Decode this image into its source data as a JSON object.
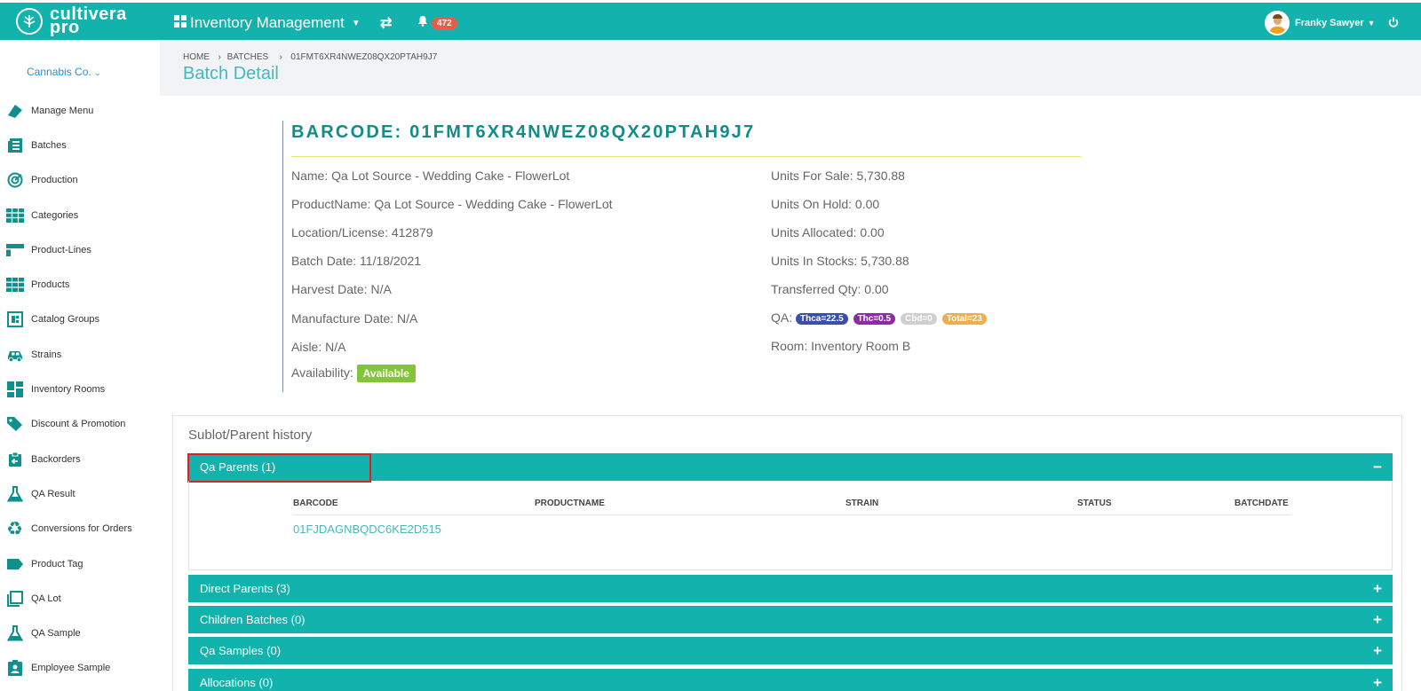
{
  "header": {
    "logo_line1": "cultivera",
    "logo_line2": "pro",
    "module_title": "Inventory Management",
    "notification_count": "472",
    "user_name": "Franky Sawyer"
  },
  "sidebar": {
    "company": "Cannabis Co.",
    "items": [
      {
        "label": "Manage Menu",
        "icon": "manage-menu-icon"
      },
      {
        "label": "Batches",
        "icon": "batches-icon"
      },
      {
        "label": "Production",
        "icon": "production-icon"
      },
      {
        "label": "Categories",
        "icon": "categories-icon"
      },
      {
        "label": "Product-Lines",
        "icon": "product-lines-icon"
      },
      {
        "label": "Products",
        "icon": "products-icon"
      },
      {
        "label": "Catalog Groups",
        "icon": "catalog-groups-icon"
      },
      {
        "label": "Strains",
        "icon": "strains-icon"
      },
      {
        "label": "Inventory Rooms",
        "icon": "inventory-rooms-icon"
      },
      {
        "label": "Discount & Promotion",
        "icon": "discount-icon"
      },
      {
        "label": "Backorders",
        "icon": "backorders-icon"
      },
      {
        "label": "QA Result",
        "icon": "qa-result-icon"
      },
      {
        "label": "Conversions for Orders",
        "icon": "recycle-icon"
      },
      {
        "label": "Product Tag",
        "icon": "tag-icon"
      },
      {
        "label": "QA Lot",
        "icon": "qa-lot-icon"
      },
      {
        "label": "QA Sample",
        "icon": "flask-icon"
      },
      {
        "label": "Employee Sample",
        "icon": "employee-sample-icon"
      }
    ]
  },
  "breadcrumb": {
    "home": "HOME",
    "batches": "BATCHES",
    "current": "01FMT6XR4NWEZ08QX20PTAH9J7"
  },
  "page_title": "Batch Detail",
  "batch": {
    "barcode_title": "BARCODE: 01FMT6XR4NWEZ08QX20PTAH9J7",
    "name": "Name: Qa Lot Source - Wedding Cake - FlowerLot",
    "product_name": "ProductName: Qa Lot Source - Wedding Cake - FlowerLot",
    "location": "Location/License: 412879",
    "batch_date": "Batch Date: 11/18/2021",
    "harvest_date": "Harvest Date: N/A",
    "manufacture_date": "Manufacture Date: N/A",
    "aisle": "Aisle: N/A",
    "availability_label": "Availability:",
    "availability_value": "Available",
    "units_for_sale": "Units For Sale: 5,730.88",
    "units_on_hold": "Units On Hold: 0.00",
    "units_allocated": "Units Allocated: 0.00",
    "units_in_stocks": "Units In Stocks: 5,730.88",
    "transferred_qty": "Transferred Qty: 0.00",
    "qa_label": "QA:",
    "qa_tags": [
      {
        "text": "Thca=22.5",
        "color": "#3a4fa8"
      },
      {
        "text": "Thc=0.5",
        "color": "#8e2aa6"
      },
      {
        "text": "Cbd=0",
        "color": "#cfcfcf"
      },
      {
        "text": "Total=23",
        "color": "#f0ad4e"
      }
    ],
    "room": "Room: Inventory Room B"
  },
  "history": {
    "title": "Sublot/Parent history",
    "sections": [
      {
        "label": "Qa Parents (1)",
        "toggle": "−"
      },
      {
        "label": "Direct Parents (3)",
        "toggle": "+"
      },
      {
        "label": "Children Batches (0)",
        "toggle": "+"
      },
      {
        "label": "Qa Samples (0)",
        "toggle": "+"
      },
      {
        "label": "Allocations (0)",
        "toggle": "+"
      }
    ],
    "table": {
      "columns": [
        "BARCODE",
        "PRODUCTNAME",
        "STRAIN",
        "STATUS",
        "BATCHDATE"
      ],
      "rows": [
        {
          "barcode": "01FJDAGNBQDC6KE2D515"
        }
      ]
    }
  },
  "colors": {
    "brand_teal": "#12b2ad",
    "title_teal": "#118c86",
    "badge_red": "#ea5c4a",
    "available_green": "#83c43a"
  }
}
